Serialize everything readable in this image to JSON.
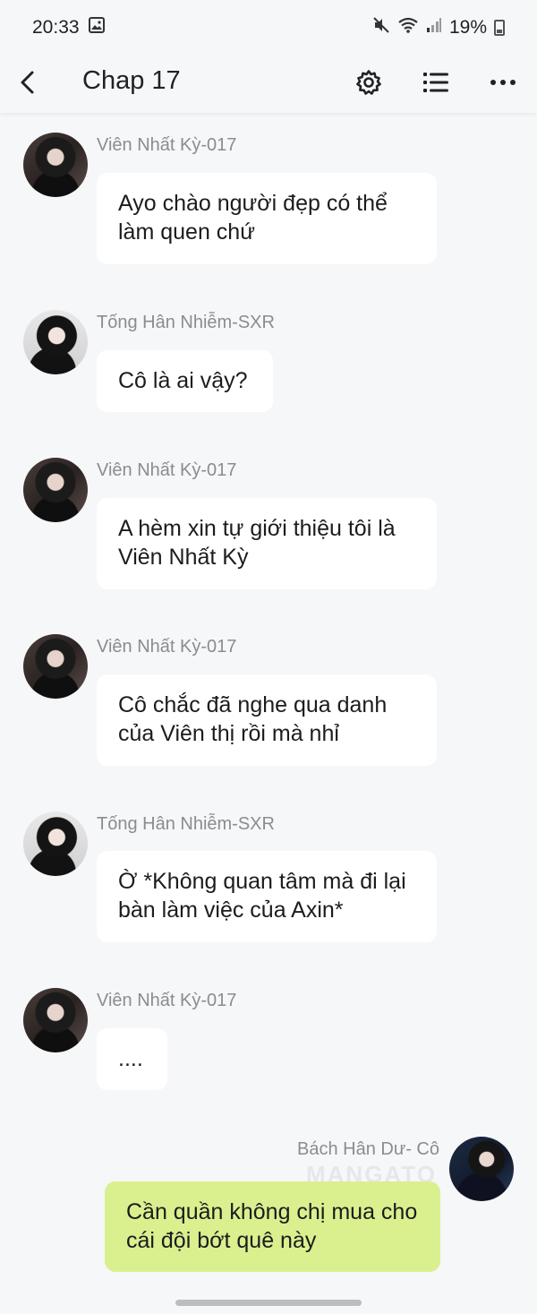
{
  "status": {
    "time": "20:33",
    "battery": "19%"
  },
  "header": {
    "title": "Chap 17"
  },
  "messages": [
    {
      "sender": "Viên Nhất Kỳ-017",
      "text": "Ayo chào người đẹp có thể làm quen chứ",
      "side": "left"
    },
    {
      "sender": "Tống Hân Nhiễm-SXR",
      "text": "Cô là ai vậy?",
      "side": "left"
    },
    {
      "sender": "Viên Nhất Kỳ-017",
      "text": "A hèm xin tự giới thiệu tôi là Viên Nhất Kỳ",
      "side": "left"
    },
    {
      "sender": "Viên Nhất Kỳ-017",
      "text": "Cô chắc đã nghe qua danh của Viên thị rồi mà nhỉ",
      "side": "left"
    },
    {
      "sender": "Tống Hân Nhiễm-SXR",
      "text": "Ờ *Không quan tâm mà đi lại bàn làm việc của Axin*",
      "side": "left"
    },
    {
      "sender": "Viên Nhất Kỳ-017",
      "text": "....",
      "side": "left"
    },
    {
      "sender": "Bách Hân Dư- Cô",
      "text": "Cần quần không chị mua cho cái đội bớt quê này",
      "side": "right"
    }
  ],
  "watermark": "MANGATO",
  "colors": {
    "background": "#f6f7f9",
    "bubble_other": "#ffffff",
    "bubble_mine": "#daf08f",
    "sender_text": "#8c8c8c"
  }
}
